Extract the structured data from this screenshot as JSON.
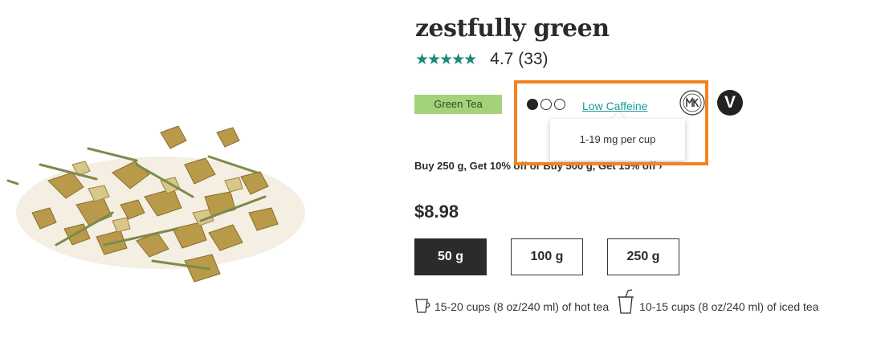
{
  "product": {
    "title": "zestfully green",
    "rating_stars": "★★★★★",
    "rating_text": "4.7 (33)",
    "rating_value": 4.7,
    "review_count": 33
  },
  "tags": {
    "tea_type": "Green Tea",
    "caffeine_link": "Low Caffeine",
    "caffeine_level": 1,
    "caffeine_max": 3,
    "caffeine_tooltip": "1-19 mg per cup",
    "vegan_letter": "V"
  },
  "promo": {
    "text": "Buy 250 g, Get 10% off or Buy 500 g, Get 15% off ›"
  },
  "price": "$8.98",
  "sizes": [
    {
      "label": "50 g",
      "selected": true
    },
    {
      "label": "100 g",
      "selected": false
    },
    {
      "label": "250 g",
      "selected": false
    }
  ],
  "servings": {
    "hot": "15-20 cups (8 oz/240 ml) of hot tea",
    "iced": "10-15 cups (8 oz/240 ml) of iced tea"
  },
  "colors": {
    "accent": "#1a8a7a",
    "tea_badge": "#a4d27a",
    "highlight": "#f58220"
  },
  "icons": [
    "tea-leaves-image",
    "hot-cup-icon",
    "iced-cup-icon",
    "mk-logo-icon",
    "vegan-badge-icon"
  ]
}
